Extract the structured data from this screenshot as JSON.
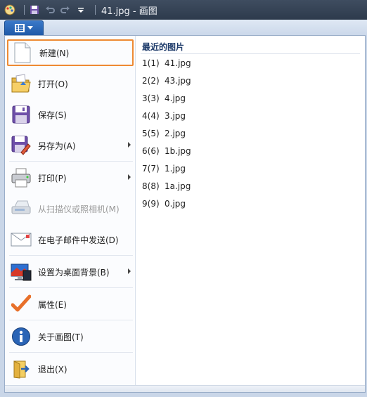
{
  "window": {
    "title": "41.jpg - 画图"
  },
  "app_menu": [
    {
      "label": "新建(N)",
      "icon": "new-file-icon",
      "highlight": true
    },
    {
      "label": "打开(O)",
      "icon": "open-folder-icon"
    },
    {
      "label": "保存(S)",
      "icon": "save-icon"
    },
    {
      "label": "另存为(A)",
      "icon": "save-as-icon",
      "submenu": true
    },
    {
      "label": "打印(P)",
      "icon": "printer-icon",
      "submenu": true
    },
    {
      "label": "从扫描仪或照相机(M)",
      "icon": "scanner-icon",
      "disabled": true
    },
    {
      "label": "在电子邮件中发送(D)",
      "icon": "email-icon"
    },
    {
      "label": "设置为桌面背景(B)",
      "icon": "desktop-background-icon",
      "submenu": true
    },
    {
      "label": "属性(E)",
      "icon": "properties-check-icon"
    },
    {
      "label": "关于画图(T)",
      "icon": "about-info-icon"
    },
    {
      "label": "退出(X)",
      "icon": "exit-icon"
    }
  ],
  "recent": {
    "title": "最近的图片",
    "items": [
      {
        "num": "1(1)",
        "name": "41.jpg"
      },
      {
        "num": "2(2)",
        "name": "43.jpg"
      },
      {
        "num": "3(3)",
        "name": "4.jpg"
      },
      {
        "num": "4(4)",
        "name": "3.jpg"
      },
      {
        "num": "5(5)",
        "name": "2.jpg"
      },
      {
        "num": "6(6)",
        "name": "1b.jpg"
      },
      {
        "num": "7(7)",
        "name": "1.jpg"
      },
      {
        "num": "8(8)",
        "name": "1a.jpg"
      },
      {
        "num": "9(9)",
        "name": "0.jpg"
      }
    ]
  },
  "colors": {
    "highlight_border": "#ee8a33",
    "menu_button": "#2a68b8",
    "title_bar": "#2d3a4c"
  }
}
